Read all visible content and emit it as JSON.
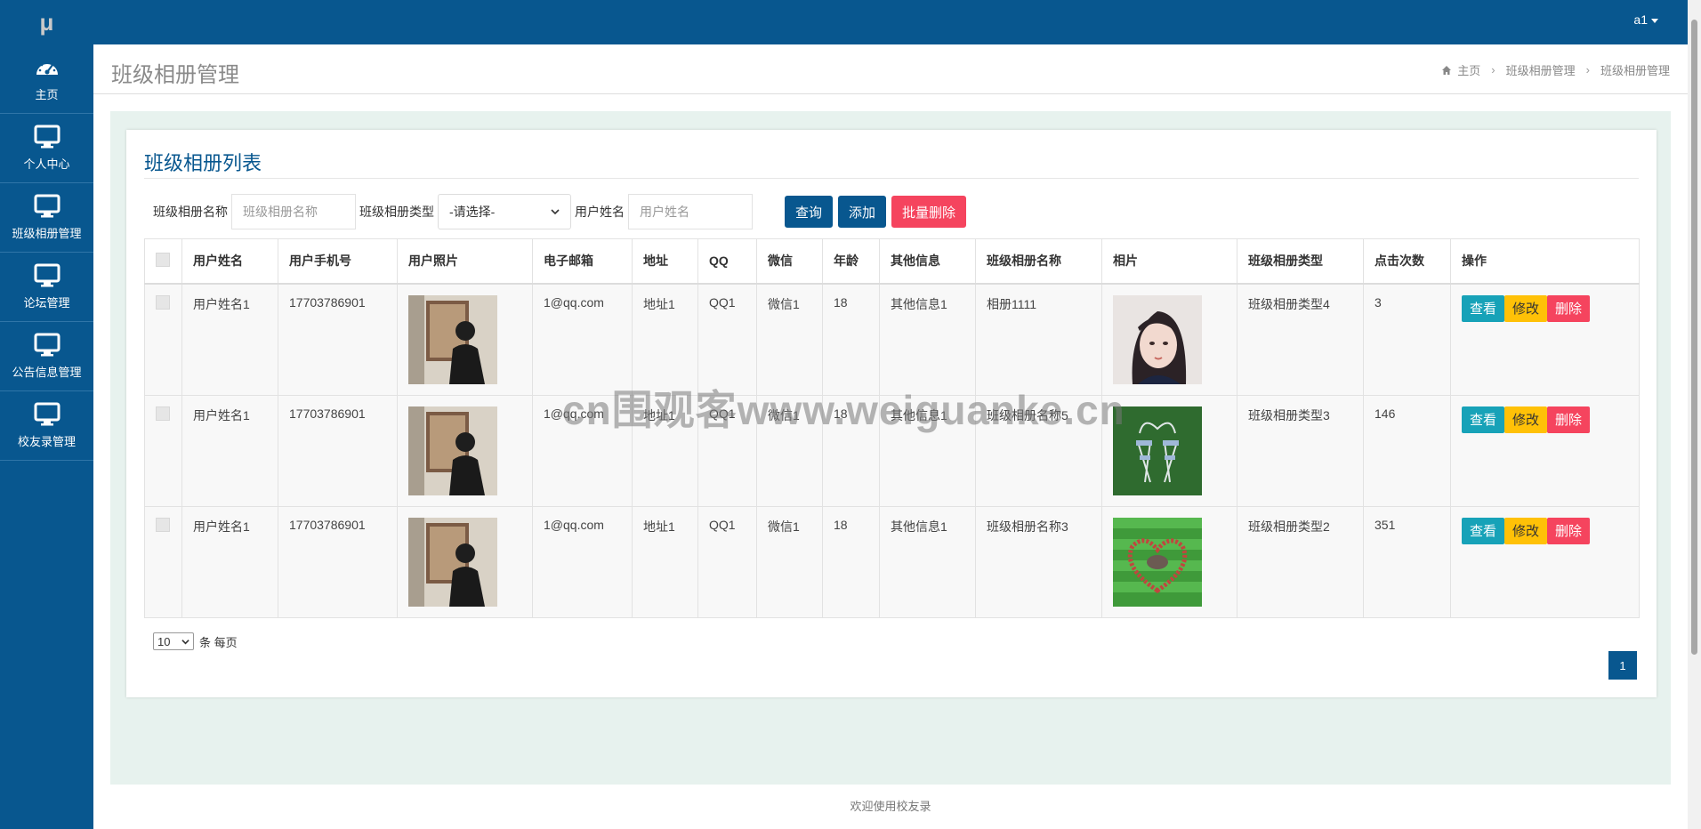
{
  "app": {
    "logo": "μ",
    "user": "a1"
  },
  "sidebar": {
    "items": [
      {
        "label": "主页",
        "icon": "dashboard-icon"
      },
      {
        "label": "个人中心",
        "icon": "monitor-icon"
      },
      {
        "label": "班级相册管理",
        "icon": "monitor-icon"
      },
      {
        "label": "论坛管理",
        "icon": "monitor-icon"
      },
      {
        "label": "公告信息管理",
        "icon": "monitor-icon"
      },
      {
        "label": "校友录管理",
        "icon": "monitor-icon"
      }
    ]
  },
  "header": {
    "title": "班级相册管理",
    "breadcrumb": [
      "主页",
      "班级相册管理",
      "班级相册管理"
    ]
  },
  "card": {
    "title": "班级相册列表"
  },
  "search": {
    "name_label": "班级相册名称",
    "name_placeholder": "班级相册名称",
    "type_label": "班级相册类型",
    "type_selected": "-请选择-",
    "user_label": "用户姓名",
    "user_placeholder": "用户姓名",
    "query_btn": "查询",
    "add_btn": "添加",
    "batch_delete_btn": "批量删除"
  },
  "table": {
    "headers": [
      "用户姓名",
      "用户手机号",
      "用户照片",
      "电子邮箱",
      "地址",
      "QQ",
      "微信",
      "年龄",
      "其他信息",
      "班级相册名称",
      "相片",
      "班级相册类型",
      "点击次数",
      "操作"
    ],
    "rows": [
      {
        "name": "用户姓名1",
        "phone": "17703786901",
        "email": "1@qq.com",
        "address": "地址1",
        "qq": "QQ1",
        "wechat": "微信1",
        "age": "18",
        "other": "其他信息1",
        "album": "相册1111",
        "photo": "portrait",
        "type": "班级相册类型4",
        "clicks": "3"
      },
      {
        "name": "用户姓名1",
        "phone": "17703786901",
        "email": "1@qq.com",
        "address": "地址1",
        "qq": "QQ1",
        "wechat": "微信1",
        "age": "18",
        "other": "其他信息1",
        "album": "班级相册名称5",
        "photo": "formation",
        "type": "班级相册类型3",
        "clicks": "146"
      },
      {
        "name": "用户姓名1",
        "phone": "17703786901",
        "email": "1@qq.com",
        "address": "地址1",
        "qq": "QQ1",
        "wechat": "微信1",
        "age": "18",
        "other": "其他信息1",
        "album": "班级相册名称3",
        "photo": "heart-field",
        "type": "班级相册类型2",
        "clicks": "351"
      }
    ],
    "ops": {
      "view": "查看",
      "edit": "修改",
      "delete": "删除"
    }
  },
  "pager": {
    "page_size": "10",
    "per_page_label": "条 每页",
    "current_page": "1"
  },
  "watermark": "cn围观客www.weiguanke.cn",
  "footer": "欢迎使用校友录",
  "colors": {
    "primary": "#08578f",
    "danger": "#f5445e",
    "info": "#17a2b8",
    "warning": "#ffc107"
  }
}
